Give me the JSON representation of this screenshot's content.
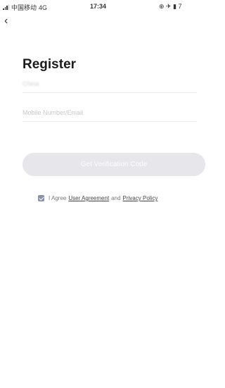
{
  "status_bar": {
    "carrier": "中国移动",
    "network": "4G",
    "time": "17:34",
    "right_icons": "⊕ ✈ ▮ 7"
  },
  "nav": {
    "back_icon": "chevron-left-icon",
    "back_glyph": "‹"
  },
  "register": {
    "title": "Register",
    "country_value": "China",
    "mobile_placeholder": "Mobile Number/Email",
    "verify_button": "Get Verification Code",
    "agreement": {
      "checked": true,
      "prefix": "I Agree",
      "user_agreement": "User Agreement",
      "and": "and",
      "privacy_policy": "Privacy Policy"
    }
  },
  "colors": {
    "button_bg": "#e6e6eb",
    "checkbox": "#8c8fa8"
  }
}
